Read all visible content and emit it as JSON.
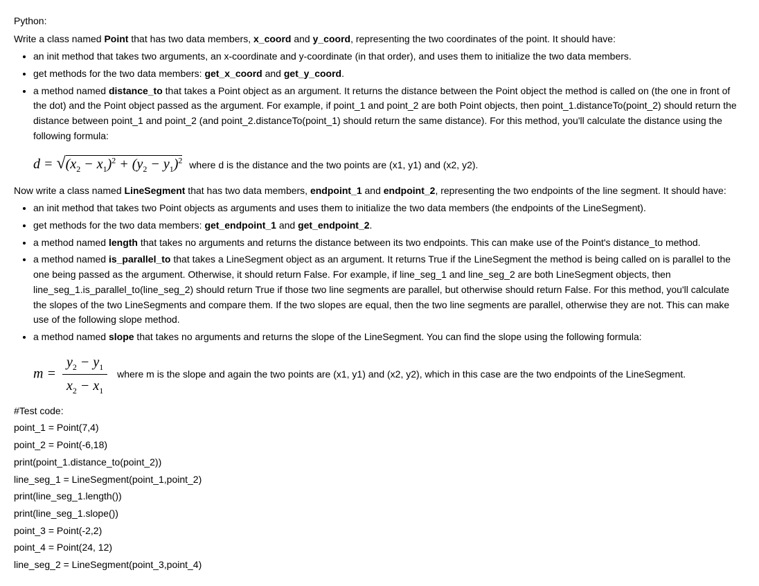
{
  "heading": "Python:",
  "point_intro_pre": "Write a class named ",
  "point_class": "Point",
  "point_intro_mid1": " that has two data members, ",
  "x_coord": "x_coord",
  "point_intro_mid2": " and ",
  "y_coord": "y_coord",
  "point_intro_post": ", representing the two coordinates of the point. It should have:",
  "point_bullets": {
    "b1": "an init method that takes two arguments, an x-coordinate and y-coordinate (in that order), and uses them to initialize the two data members.",
    "b2_pre": "get methods for the two data members: ",
    "b2_m1": "get_x_coord",
    "b2_mid": " and ",
    "b2_m2": "get_y_coord",
    "b2_post": ".",
    "b3_pre": "a method named ",
    "b3_m": "distance_to",
    "b3_post": " that takes a Point object as an argument. It returns the distance between the Point object the method is called on (the one in front of the dot) and the Point object passed as the argument. For example, if point_1 and point_2 are both Point objects, then point_1.distanceTo(point_2) should return the distance between point_1 and point_2 (and point_2.distanceTo(point_1) should return the same distance). For this method, you'll calculate the distance using the following formula:"
  },
  "dist_where": " where d is the distance and the two points are (x1, y1) and (x2, y2).",
  "ls_intro_pre": "Now write a class named ",
  "ls_class": "LineSegment",
  "ls_intro_mid1": " that has two data members, ",
  "ep1": "endpoint_1",
  "ls_intro_mid2": " and ",
  "ep2": "endpoint_2",
  "ls_intro_post": ", representing the two endpoints of the line segment. It should have:",
  "ls_bullets": {
    "b1": "an init method that takes two Point objects as arguments and uses them to initialize the two data members (the endpoints of the LineSegment).",
    "b2_pre": "get methods for the two data members: ",
    "b2_m1": "get_endpoint_1",
    "b2_mid": " and ",
    "b2_m2": "get_endpoint_2",
    "b2_post": ".",
    "b3_pre": "a method named ",
    "b3_m": "length",
    "b3_post": " that takes no arguments and returns the distance between its two endpoints. This can make use of the Point's distance_to method.",
    "b4_pre": "a method named ",
    "b4_m": "is_parallel_to",
    "b4_post": " that takes a LineSegment object as an argument. It returns True if the LineSegment the method is being called on is parallel to the one being passed as the argument. Otherwise, it should return False. For example, if line_seg_1 and line_seg_2 are both LineSegment objects, then line_seg_1.is_parallel_to(line_seg_2) should return True if those two line segments are parallel, but otherwise should return False. For this method, you'll calculate the slopes of the two LineSegments and compare them. If the two slopes are equal, then the two line segments are parallel, otherwise they are not. This can make use of the following slope method.",
    "b5_pre": "a method named ",
    "b5_m": "slope",
    "b5_post": " that takes no arguments and returns the slope of the LineSegment. You can find the slope using the following formula:"
  },
  "slope_where": " where m is the slope and again the two points are (x1, y1) and (x2, y2), which in this case are the two endpoints of the LineSegment.",
  "test": {
    "h": "#Test code:",
    "l1": "point_1 = Point(7,4)",
    "l2": "point_2 = Point(-6,18)",
    "l3": "print(point_1.distance_to(point_2))",
    "l4": "line_seg_1 = LineSegment(point_1,point_2)",
    "l5": "print(line_seg_1.length())",
    "l6": "print(line_seg_1.slope())",
    "l7": "point_3 = Point(-2,2)",
    "l8": "point_4 = Point(24, 12)",
    "l9": "line_seg_2 = LineSegment(point_3,point_4)"
  },
  "math": {
    "d_eq": "d = ",
    "m_eq": "m = ",
    "x": "x",
    "y": "y",
    "minus": " − ",
    "plus": " + ",
    "lp": "(",
    "rp": ")",
    "s1": "1",
    "s2": "2"
  }
}
